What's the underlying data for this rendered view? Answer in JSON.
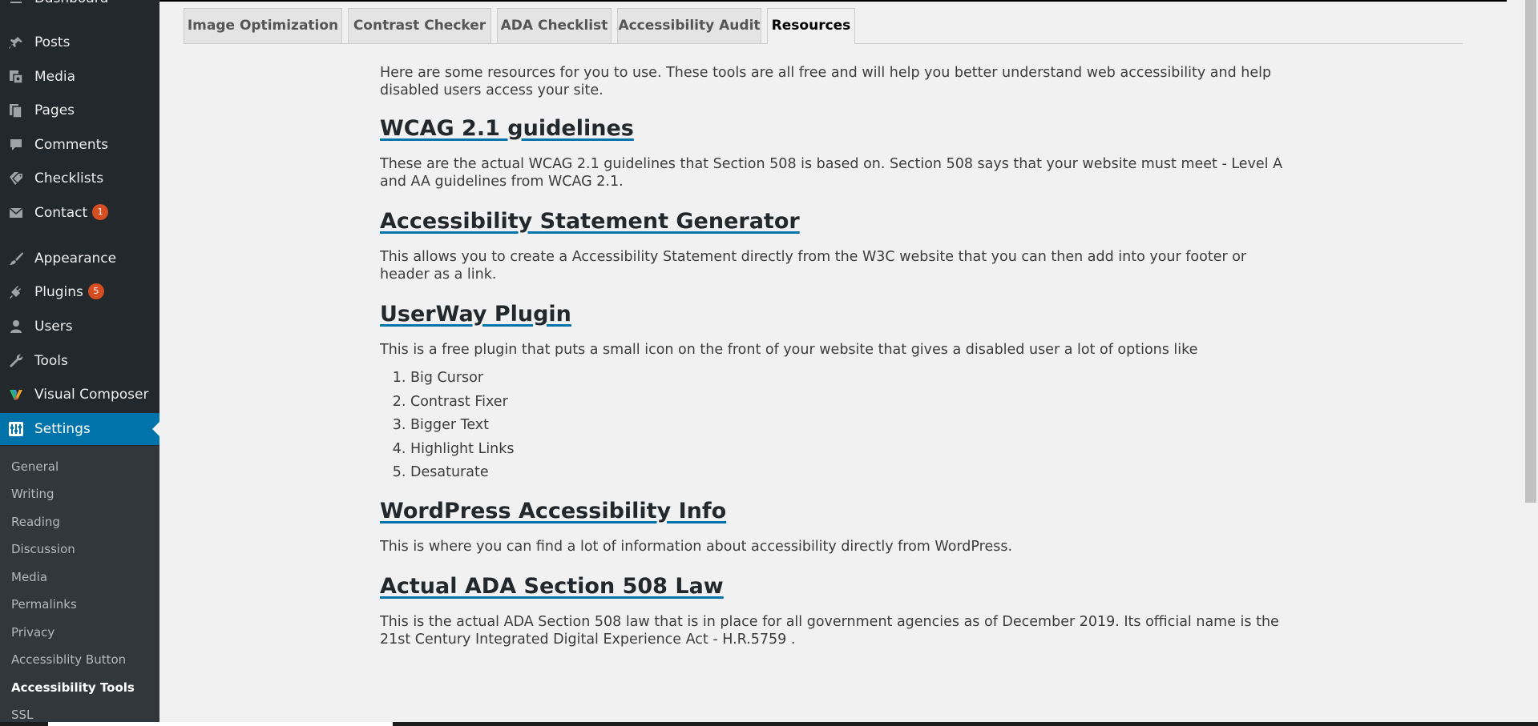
{
  "sidebar": {
    "dashboard_label": "Dashboard",
    "menu": [
      {
        "label": "Posts",
        "icon": "pin-icon"
      },
      {
        "label": "Media",
        "icon": "media-icon"
      },
      {
        "label": "Pages",
        "icon": "pages-icon"
      },
      {
        "label": "Comments",
        "icon": "comment-icon"
      },
      {
        "label": "Checklists",
        "icon": "tags-icon"
      },
      {
        "label": "Contact",
        "icon": "mail-icon",
        "badge": "1"
      },
      {
        "label": "Appearance",
        "icon": "brush-icon"
      },
      {
        "label": "Plugins",
        "icon": "plug-icon",
        "badge": "5"
      },
      {
        "label": "Users",
        "icon": "user-icon"
      },
      {
        "label": "Tools",
        "icon": "wrench-icon"
      },
      {
        "label": "Visual Composer",
        "icon": "vc-logo-icon"
      },
      {
        "label": "Settings",
        "icon": "settings-icon",
        "active": true
      }
    ],
    "submenu": [
      "General",
      "Writing",
      "Reading",
      "Discussion",
      "Media",
      "Permalinks",
      "Privacy",
      "Accessiblity Button",
      "Accessibility Tools",
      "SSL"
    ],
    "submenu_current": "Accessibility Tools"
  },
  "tabs": [
    {
      "label": "Image Optimization",
      "active": false
    },
    {
      "label": "Contrast Checker",
      "active": false
    },
    {
      "label": "ADA Checklist",
      "active": false
    },
    {
      "label": "Accessibility Audit",
      "active": false
    },
    {
      "label": "Resources",
      "active": true
    }
  ],
  "content": {
    "intro": "Here are some resources for you to use. These tools are all free and will help you better understand web accessibility and help disabled users access your site.",
    "sections": [
      {
        "heading": "WCAG 2.1 guidelines",
        "text": "These are the actual WCAG 2.1 guidelines that Section 508 is based on. Section 508 says that your website must meet - Level A and AA guidelines from WCAG 2.1."
      },
      {
        "heading": "Accessibility Statement Generator",
        "text": "This allows you to create a Accessibility Statement directly from the W3C website that you can then add into your footer or header as a link."
      },
      {
        "heading": "UserWay Plugin",
        "text": "This is a free plugin that puts a small icon on the front of your website that gives a disabled user a lot of options like",
        "list": [
          "Big Cursor",
          "Contrast Fixer",
          "Bigger Text",
          "Highlight Links",
          "Desaturate"
        ]
      },
      {
        "heading": "WordPress Accessibility Info",
        "text": "This is where you can find a lot of information about accessibility directly from WordPress."
      },
      {
        "heading": "Actual ADA Section 508 Law",
        "text": "This is the actual ADA Section 508 law that is in place for all government agencies as of December 2019. Its official name is the 21st Century Integrated Digital Experience Act - H.R.5759 ."
      }
    ]
  },
  "colors": {
    "sidebar_bg": "#23282d",
    "submenu_bg": "#32373c",
    "active_blue": "#0073aa",
    "badge_orange": "#d54e21",
    "content_bg": "#f1f1f1"
  }
}
